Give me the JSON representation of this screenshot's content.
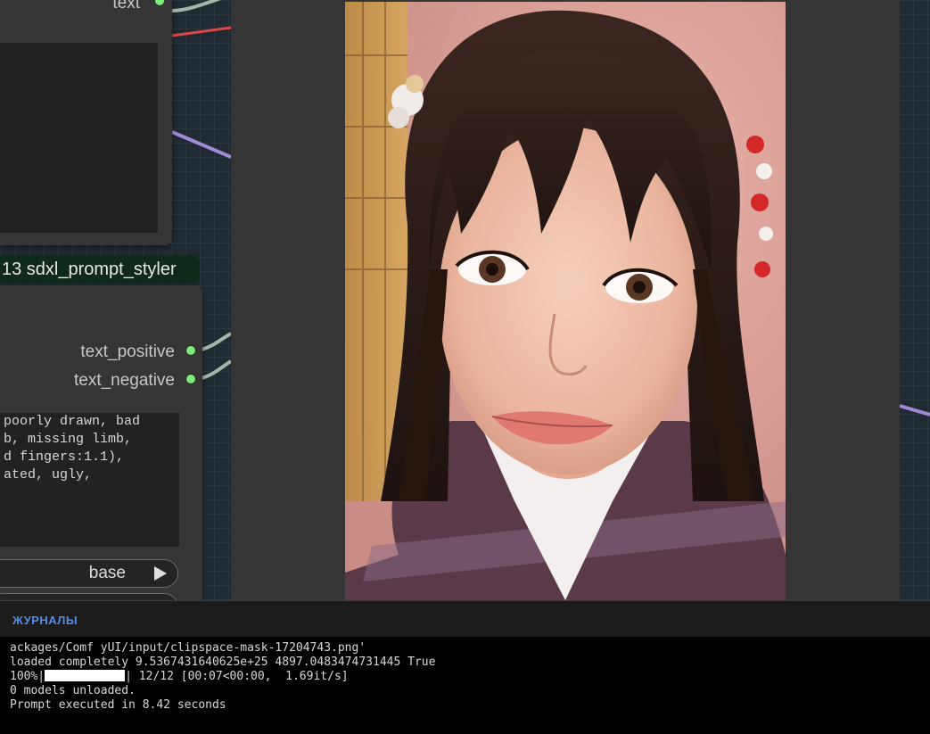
{
  "top_node": {
    "output_label": "text"
  },
  "styler_node": {
    "title": "13 sdxl_prompt_styler",
    "outputs": [
      "text_positive",
      "text_negative"
    ],
    "negative_prompt_lines": [
      "poorly drawn, bad",
      "b, missing limb,",
      "d fingers:1.1),",
      "ated, ugly,"
    ],
    "style_combo_value": "base"
  },
  "logs": {
    "title": "ЖУРНАЛЫ",
    "lines": [
      "ackages/Comf yUI/input/clipspace-mask-17204743.png'",
      "loaded completely 9.5367431640625e+25 4897.0483474731445 True",
      "0 models unloaded.",
      "Prompt executed in 8.42 seconds"
    ],
    "progress": {
      "prefix": "100%|",
      "suffix": "| 12/12 [00:07<00:00,  1.69it/s]",
      "fraction": 1.0
    }
  },
  "colors": {
    "output_dot": "#7dea78",
    "logs_title": "#4f8fe8",
    "wire_red": "#e04848",
    "wire_purple": "#a08ad6",
    "wire_gray": "#a8b4a8"
  }
}
